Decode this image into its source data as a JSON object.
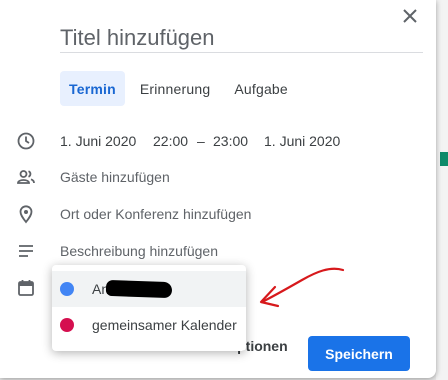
{
  "dialog": {
    "title_placeholder": "Titel hinzufügen",
    "tabs": [
      {
        "label": "Termin",
        "active": true
      },
      {
        "label": "Erinnerung",
        "active": false
      },
      {
        "label": "Aufgabe",
        "active": false
      }
    ],
    "datetime": {
      "start_date": "1. Juni 2020",
      "start_time": "22:00",
      "separator": "–",
      "end_time": "23:00",
      "end_date": "1. Juni 2020"
    },
    "guests_label": "Gäste hinzufügen",
    "location_label": "Ort oder Konferenz hinzufügen",
    "description_label": "Beschreibung hinzufügen",
    "more_options_label": "Weitere Optionen",
    "save_label": "Speichern"
  },
  "calendar_dropdown": {
    "items": [
      {
        "label": "An",
        "color": "#4285f4",
        "selected": true
      },
      {
        "label": "gemeinsamer Kalender",
        "color": "#d50f4f",
        "selected": false
      }
    ]
  },
  "colors": {
    "accent": "#1a73e8",
    "tab_active_bg": "#e8f0fe",
    "annotation": "#d7191c"
  }
}
